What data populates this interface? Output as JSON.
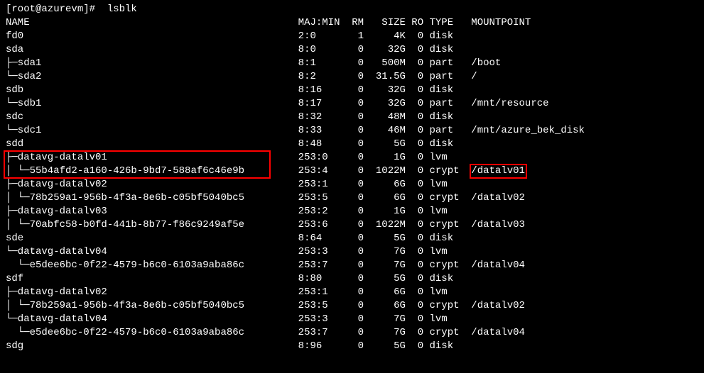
{
  "prompt": "[root@azurevm]#  lsblk",
  "header": {
    "name": "NAME",
    "majmin": "MAJ:MIN",
    "rm": "RM",
    "size": "SIZE",
    "ro": "RO",
    "type": "TYPE",
    "mount": "MOUNTPOINT"
  },
  "rows": [
    {
      "name": "fd0",
      "majmin": "2:0",
      "rm": "1",
      "size": "4K",
      "ro": "0",
      "type": "disk",
      "mount": ""
    },
    {
      "name": "sda",
      "majmin": "8:0",
      "rm": "0",
      "size": "32G",
      "ro": "0",
      "type": "disk",
      "mount": ""
    },
    {
      "name": "├─sda1",
      "majmin": "8:1",
      "rm": "0",
      "size": "500M",
      "ro": "0",
      "type": "part",
      "mount": "/boot"
    },
    {
      "name": "└─sda2",
      "majmin": "8:2",
      "rm": "0",
      "size": "31.5G",
      "ro": "0",
      "type": "part",
      "mount": "/"
    },
    {
      "name": "sdb",
      "majmin": "8:16",
      "rm": "0",
      "size": "32G",
      "ro": "0",
      "type": "disk",
      "mount": ""
    },
    {
      "name": "└─sdb1",
      "majmin": "8:17",
      "rm": "0",
      "size": "32G",
      "ro": "0",
      "type": "part",
      "mount": "/mnt/resource"
    },
    {
      "name": "sdc",
      "majmin": "8:32",
      "rm": "0",
      "size": "48M",
      "ro": "0",
      "type": "disk",
      "mount": ""
    },
    {
      "name": "└─sdc1",
      "majmin": "8:33",
      "rm": "0",
      "size": "46M",
      "ro": "0",
      "type": "part",
      "mount": "/mnt/azure_bek_disk"
    },
    {
      "name": "sdd",
      "majmin": "8:48",
      "rm": "0",
      "size": "5G",
      "ro": "0",
      "type": "disk",
      "mount": ""
    },
    {
      "name": "├─datavg-datalv01",
      "majmin": "253:0",
      "rm": "0",
      "size": "1G",
      "ro": "0",
      "type": "lvm",
      "mount": ""
    },
    {
      "name": "│ └─55b4afd2-a160-426b-9bd7-588af6c46e9b",
      "majmin": "253:4",
      "rm": "0",
      "size": "1022M",
      "ro": "0",
      "type": "crypt",
      "mount": "/datalv01"
    },
    {
      "name": "├─datavg-datalv02",
      "majmin": "253:1",
      "rm": "0",
      "size": "6G",
      "ro": "0",
      "type": "lvm",
      "mount": ""
    },
    {
      "name": "│ └─78b259a1-956b-4f3a-8e6b-c05bf5040bc5",
      "majmin": "253:5",
      "rm": "0",
      "size": "6G",
      "ro": "0",
      "type": "crypt",
      "mount": "/datalv02"
    },
    {
      "name": "├─datavg-datalv03",
      "majmin": "253:2",
      "rm": "0",
      "size": "1G",
      "ro": "0",
      "type": "lvm",
      "mount": ""
    },
    {
      "name": "│ └─70abfc58-b0fd-441b-8b77-f86c9249af5e",
      "majmin": "253:6",
      "rm": "0",
      "size": "1022M",
      "ro": "0",
      "type": "crypt",
      "mount": "/datalv03"
    },
    {
      "name": "sde",
      "majmin": "8:64",
      "rm": "0",
      "size": "5G",
      "ro": "0",
      "type": "disk",
      "mount": ""
    },
    {
      "name": "└─datavg-datalv04",
      "majmin": "253:3",
      "rm": "0",
      "size": "7G",
      "ro": "0",
      "type": "lvm",
      "mount": ""
    },
    {
      "name": "  └─e5dee6bc-0f22-4579-b6c0-6103a9aba86c",
      "majmin": "253:7",
      "rm": "0",
      "size": "7G",
      "ro": "0",
      "type": "crypt",
      "mount": "/datalv04"
    },
    {
      "name": "sdf",
      "majmin": "8:80",
      "rm": "0",
      "size": "5G",
      "ro": "0",
      "type": "disk",
      "mount": ""
    },
    {
      "name": "├─datavg-datalv02",
      "majmin": "253:1",
      "rm": "0",
      "size": "6G",
      "ro": "0",
      "type": "lvm",
      "mount": ""
    },
    {
      "name": "│ └─78b259a1-956b-4f3a-8e6b-c05bf5040bc5",
      "majmin": "253:5",
      "rm": "0",
      "size": "6G",
      "ro": "0",
      "type": "crypt",
      "mount": "/datalv02"
    },
    {
      "name": "└─datavg-datalv04",
      "majmin": "253:3",
      "rm": "0",
      "size": "7G",
      "ro": "0",
      "type": "lvm",
      "mount": ""
    },
    {
      "name": "  └─e5dee6bc-0f22-4579-b6c0-6103a9aba86c",
      "majmin": "253:7",
      "rm": "0",
      "size": "7G",
      "ro": "0",
      "type": "crypt",
      "mount": "/datalv04"
    },
    {
      "name": "sdg",
      "majmin": "8:96",
      "rm": "0",
      "size": "5G",
      "ro": "0",
      "type": "disk",
      "mount": ""
    }
  ],
  "highlight_row_indices": [
    9,
    10
  ],
  "highlight_mount_index": 10
}
